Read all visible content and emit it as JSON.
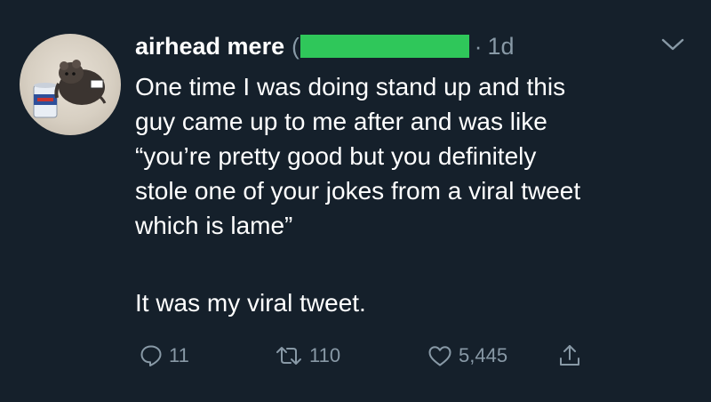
{
  "tweet": {
    "author_name": "airhead mere",
    "handle_open": "(",
    "dot": "·",
    "time": "1d",
    "body_lines": [
      "One time I was doing stand up and this",
      "guy came up to me after and was like",
      "“you’re pretty good but you definitely",
      "stole one of your jokes from a viral tweet",
      "which is lame”"
    ],
    "body_last": "It was my viral tweet.",
    "counts": {
      "replies": "11",
      "retweets": "110",
      "likes": "5,445"
    }
  },
  "colors": {
    "background": "#15202b",
    "text": "#ffffff",
    "muted": "#8899a6",
    "redaction": "#2fc75a"
  },
  "icons": {
    "reply": "reply-icon",
    "retweet": "retweet-icon",
    "like": "heart-icon",
    "share": "share-icon",
    "caret": "chevron-down-icon"
  }
}
